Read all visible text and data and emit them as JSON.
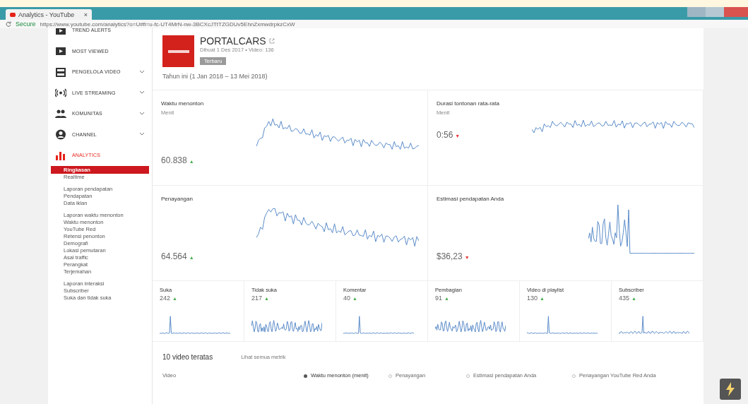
{
  "browser": {
    "tab_title": "Analytics - YouTube",
    "close": "×",
    "security": "Secure",
    "url": "https://www.youtube.com/analytics?o=U#fi=u-fc-UT4MrN-nw-3BCXcJTtTZGDUv5EhnZxmwdrpkzCxW"
  },
  "sidebar": {
    "items": [
      {
        "label": "TREND ALERTS",
        "kind": "video",
        "expandable": false,
        "active": false
      },
      {
        "label": "MOST VIEWED",
        "kind": "video",
        "expandable": false,
        "active": false
      },
      {
        "label": "PENGELOLA VIDEO",
        "kind": "film",
        "expandable": true,
        "active": false
      },
      {
        "label": "LIVE STREAMING",
        "kind": "live",
        "expandable": true,
        "active": false
      },
      {
        "label": "KOMUNITAS",
        "kind": "people",
        "expandable": true,
        "active": false
      },
      {
        "label": "CHANNEL",
        "kind": "person",
        "expandable": true,
        "active": false
      },
      {
        "label": "ANALYTICS",
        "kind": "bars",
        "expandable": false,
        "active": true
      }
    ],
    "subgroups": [
      {
        "items": [
          {
            "label": "Ringkasan",
            "selected": true
          },
          {
            "label": "Realtime",
            "selected": false
          }
        ]
      },
      {
        "items": [
          {
            "label": "Laporan pendapatan",
            "selected": false
          },
          {
            "label": "Pendapatan",
            "selected": false
          },
          {
            "label": "Data iklan",
            "selected": false
          }
        ]
      },
      {
        "items": [
          {
            "label": "Laporan waktu menonton",
            "selected": false
          },
          {
            "label": "Waktu menonton",
            "selected": false
          },
          {
            "label": "YouTube Red",
            "selected": false
          },
          {
            "label": "Retensi penonton",
            "selected": false
          },
          {
            "label": "Demografi",
            "selected": false
          },
          {
            "label": "Lokasi pemutaran",
            "selected": false
          },
          {
            "label": "Asal traffic",
            "selected": false
          },
          {
            "label": "Perangkat",
            "selected": false
          },
          {
            "label": "Terjemahan",
            "selected": false
          }
        ]
      },
      {
        "items": [
          {
            "label": "Laporan interaksi",
            "selected": false
          },
          {
            "label": "Subscriber",
            "selected": false
          },
          {
            "label": "Suka dan tidak suka",
            "selected": false
          }
        ]
      }
    ]
  },
  "channel": {
    "name": "PORTALCARS",
    "meta": "Dibuat 1 Des 2017 • Video: 136",
    "badge": "Terbaru",
    "period": "Tahun ini (1 Jan 2018 – 13 Mei 2018)"
  },
  "metrics": [
    {
      "title": "Waktu menonton",
      "unit": "Menit",
      "value": "60.838",
      "arrow": "▲",
      "rising": true
    },
    {
      "title": "Durasi tontonan rata-rata",
      "unit": "Menit",
      "value": "0:56",
      "arrow": "▼",
      "rising": false
    },
    {
      "title": "Penayangan",
      "value": "64.564",
      "arrow": "▲",
      "rising": true
    },
    {
      "title": "Estimasi pendapatan Anda",
      "value": "$36,23",
      "arrow": "▼",
      "rising": false
    }
  ],
  "small_metrics": [
    {
      "title": "Suka",
      "value": "242",
      "arrow": "▲",
      "rising": true
    },
    {
      "title": "Tidak suka",
      "value": "217",
      "arrow": "▲",
      "rising": true
    },
    {
      "title": "Komentar",
      "value": "40",
      "arrow": "▲",
      "rising": true
    },
    {
      "title": "Pembagian",
      "value": "91",
      "arrow": "▲",
      "rising": true
    },
    {
      "title": "Video di playlist",
      "value": "130",
      "arrow": "▲",
      "rising": true
    },
    {
      "title": "Subscriber",
      "value": "435",
      "arrow": "▲",
      "rising": true
    }
  ],
  "top_videos": {
    "title": "10 video teratas",
    "link": "Lihat semua metrik",
    "columns": [
      {
        "label": "Video",
        "selected": false
      },
      {
        "label": "Waktu menonton (menit)",
        "selected": true
      },
      {
        "label": "Penayangan",
        "selected": false
      },
      {
        "label": "Estimasi pendapatan Anda",
        "selected": false
      },
      {
        "label": "Penayangan YouTube Red Anda",
        "selected": false
      }
    ]
  }
}
